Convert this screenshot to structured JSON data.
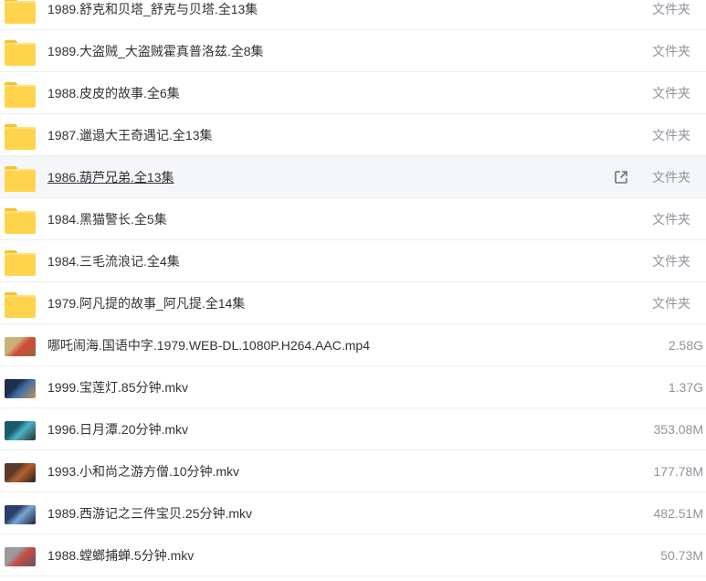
{
  "files": [
    {
      "name": "1989.舒克和贝塔_舒克与贝塔.全13集",
      "meta": "文件夹",
      "kind": "folder"
    },
    {
      "name": "1989.大盗贼_大盗贼霍真普洛兹.全8集",
      "meta": "文件夹",
      "kind": "folder"
    },
    {
      "name": "1988.皮皮的故事.全6集",
      "meta": "文件夹",
      "kind": "folder"
    },
    {
      "name": "1987.邋遢大王奇遇记.全13集",
      "meta": "文件夹",
      "kind": "folder"
    },
    {
      "name": "1986.葫芦兄弟.全13集",
      "meta": "文件夹",
      "kind": "folder",
      "hover": true
    },
    {
      "name": "1984.黑猫警长.全5集",
      "meta": "文件夹",
      "kind": "folder"
    },
    {
      "name": "1984.三毛流浪记.全4集",
      "meta": "文件夹",
      "kind": "folder"
    },
    {
      "name": "1979.阿凡提的故事_阿凡提.全14集",
      "meta": "文件夹",
      "kind": "folder"
    },
    {
      "name": "哪吒闹海.国语中字.1979.WEB-DL.1080P.H264.AAC.mp4",
      "meta": "2.58G",
      "kind": "video",
      "palette": [
        "#c9b27a",
        "#d64a3a",
        "#8c6a3a"
      ]
    },
    {
      "name": "1999.宝莲灯.85分钟.mkv",
      "meta": "1.37G",
      "kind": "video",
      "palette": [
        "#1d2f4a",
        "#3e6ea8",
        "#c79055"
      ]
    },
    {
      "name": "1996.日月潭.20分钟.mkv",
      "meta": "353.08M",
      "kind": "video",
      "palette": [
        "#1b5a6a",
        "#49b3c7",
        "#2c2c2c"
      ]
    },
    {
      "name": "1993.小和尚之游方僧.10分钟.mkv",
      "meta": "177.78M",
      "kind": "video",
      "palette": [
        "#5c3a2a",
        "#b3612f",
        "#2a1e1a"
      ]
    },
    {
      "name": "1989.西游记之三件宝贝.25分钟.mkv",
      "meta": "482.51M",
      "kind": "video",
      "palette": [
        "#2a3f6a",
        "#7aa5d6",
        "#1b2236"
      ]
    },
    {
      "name": "1988.螳螂捕蝉.5分钟.mkv",
      "meta": "50.73M",
      "kind": "video",
      "palette": [
        "#9a9a9a",
        "#c94b43",
        "#5a5a5a"
      ]
    }
  ],
  "icons": {
    "folder": "folder-icon",
    "video": "video-thumbnail",
    "share": "share-icon"
  }
}
